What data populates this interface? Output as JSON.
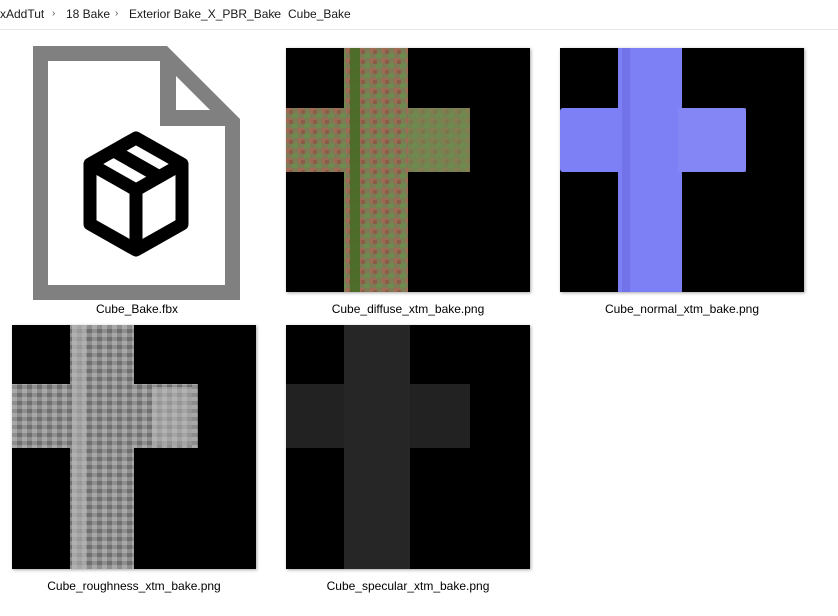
{
  "breadcrumb": {
    "items": [
      "xAddTut",
      "18 Bake",
      "Exterior Bake_X_PBR_Bake",
      "Cube_Bake"
    ],
    "separator": "›"
  },
  "files": [
    {
      "name": "Cube_Bake.fbx",
      "icon": "fbx-file-icon"
    },
    {
      "name": "Cube_diffuse_xtm_bake.png",
      "texture": "diffuse"
    },
    {
      "name": "Cube_normal_xtm_bake.png",
      "texture": "normal"
    },
    {
      "name": "Cube_roughness_xtm_bake.png",
      "texture": "roughness"
    },
    {
      "name": "Cube_specular_xtm_bake.png",
      "texture": "specular"
    }
  ],
  "colors": {
    "normal_map": "#7f7ff5",
    "diffuse_base": "#7d8a5a",
    "roughness_base": "#9a9a9a",
    "specular_base": "#2a2a2a",
    "background_black": "#000000"
  }
}
